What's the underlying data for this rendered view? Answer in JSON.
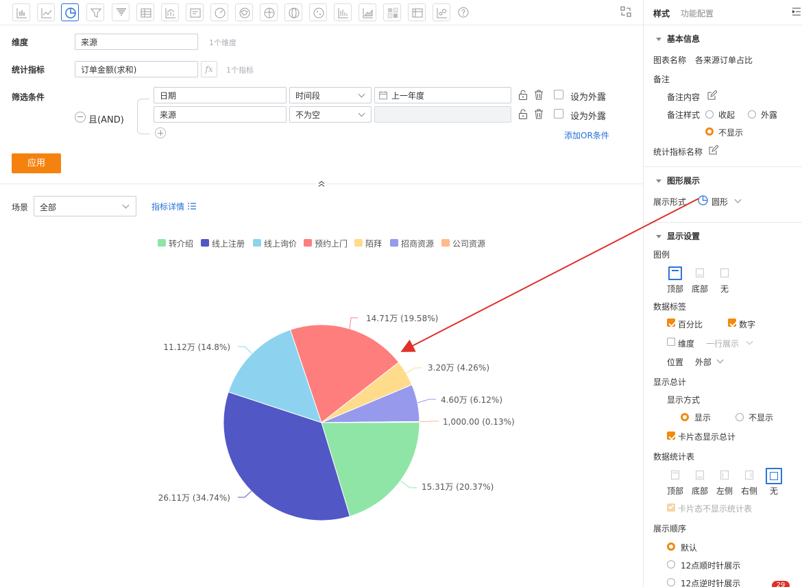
{
  "toolbar": {
    "icons": [
      "bar-chart-icon",
      "line-chart-icon",
      "pie-chart-icon",
      "funnel-chart-icon",
      "funnel-alt-chart-icon",
      "table-icon",
      "combo-chart-icon",
      "card-icon",
      "gauge-icon",
      "china-map-icon",
      "world-map-icon",
      "globe-map-icon",
      "scatter-map-icon",
      "histogram-icon",
      "area-chart-icon",
      "heatmap-icon",
      "pivot-table-icon",
      "bubble-chart-icon",
      "help-icon"
    ],
    "active_icon": "pie-chart-icon",
    "swap_icon": "swap-icon"
  },
  "query": {
    "dimension_label": "维度",
    "dimension_value": "来源",
    "dimension_hint": "1个维度",
    "metric_label": "统计指标",
    "metric_value": "订单金额(求和)",
    "fx_label": "fx",
    "metric_hint": "1个指标",
    "filter_label": "筛选条件",
    "logic_label": "且(AND)",
    "filters": [
      {
        "field": "日期",
        "operator": "时间段",
        "value": "上一年度",
        "expose_label": "设为外露"
      },
      {
        "field": "来源",
        "operator": "不为空",
        "value": "",
        "expose_label": "设为外露"
      }
    ],
    "add_or_label": "添加OR条件",
    "apply_label": "应用"
  },
  "scene": {
    "label": "场景",
    "value": "全部",
    "detail_label": "指标详情"
  },
  "chart_data": {
    "type": "pie",
    "categories": [
      "转介绍",
      "线上注册",
      "线上询价",
      "预约上门",
      "陌拜",
      "招商资源",
      "公司资源"
    ],
    "values": [
      15.31,
      26.11,
      11.12,
      14.71,
      3.2,
      4.6,
      0.1
    ],
    "unit": "万",
    "labels": [
      "15.31万 (20.37%)",
      "26.11万 (34.74%)",
      "11.12万 (14.8%)",
      "14.71万 (19.58%)",
      "3.20万 (4.26%)",
      "4.60万 (6.12%)",
      "1,000.00 (0.13%)"
    ],
    "percents": [
      20.37,
      34.74,
      14.8,
      19.58,
      4.26,
      6.12,
      0.13
    ],
    "colors": [
      "#8fe5a6",
      "#5157c4",
      "#8dd3ef",
      "#fe7e7e",
      "#ffdb8c",
      "#9699ec",
      "#ffb98a"
    ],
    "legend_position": "top"
  },
  "panel": {
    "tabs": [
      "样式",
      "功能配置"
    ],
    "collapse_icon": "collapse-icon",
    "basic_title": "基本信息",
    "chart_name_label": "图表名称",
    "chart_name_value": "各来源订单占比",
    "note_label": "备注",
    "note_content_label": "备注内容",
    "note_style_label": "备注样式",
    "note_style_options": [
      "收起",
      "外露",
      "不显示"
    ],
    "note_style_selected": "不显示",
    "metric_name_label": "统计指标名称",
    "graphic_title": "图形展示",
    "display_form_label": "展示形式",
    "display_form_value": "圆形",
    "display_settings_title": "显示设置",
    "legend_label": "图例",
    "legend_options": [
      "顶部",
      "底部",
      "无"
    ],
    "legend_selected": "顶部",
    "data_label_title": "数据标签",
    "percent_label": "百分比",
    "number_label": "数字",
    "dimension_cb_label": "维度",
    "one_line_label": "一行展示",
    "position_label": "位置",
    "position_value": "外部",
    "total_title": "显示总计",
    "total_mode_label": "显示方式",
    "total_options": [
      "显示",
      "不显示"
    ],
    "total_selected": "显示",
    "card_total_label": "卡片态显示总计",
    "stats_table_title": "数据统计表",
    "stats_table_options": [
      "顶部",
      "底部",
      "左侧",
      "右侧",
      "无"
    ],
    "stats_table_selected": "无",
    "card_no_stats_label": "卡片态不显示统计表",
    "order_title": "展示顺序",
    "order_options": [
      "默认",
      "12点顺时针展示",
      "12点逆时针展示"
    ],
    "order_selected": "默认",
    "badge": "29"
  },
  "colors": {
    "accent": "#f28a10",
    "link": "#1f6fd8",
    "arrow": "#e0302a"
  }
}
